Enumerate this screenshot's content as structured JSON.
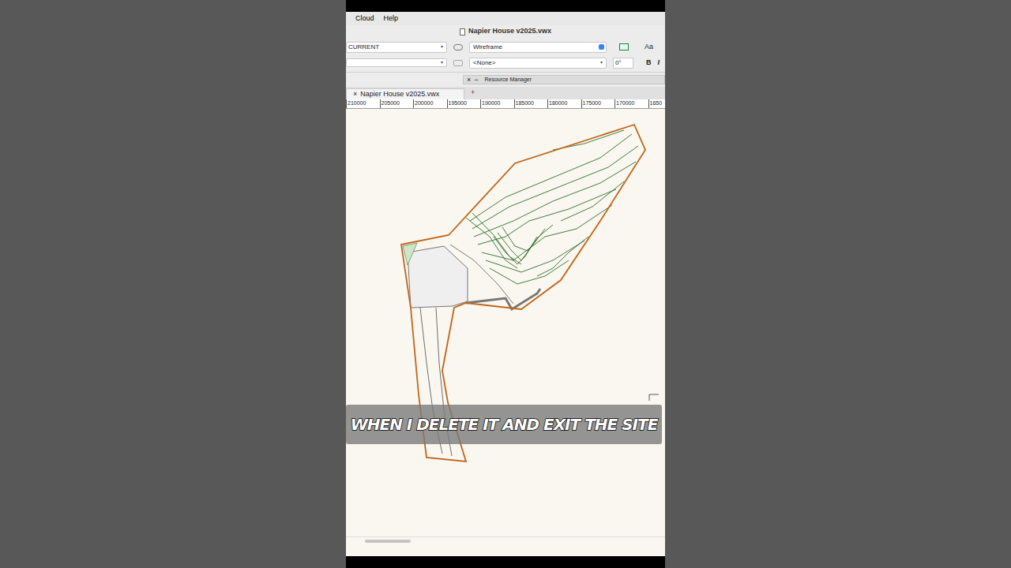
{
  "menu": [
    "Cloud",
    "Help"
  ],
  "window": {
    "title": "Napier House v2025.vwx"
  },
  "toolbar": {
    "class_field": "CURRENT",
    "render_mode": "Wireframe",
    "plane_field": "<None>",
    "rotation": "0°",
    "text_style": "Aa",
    "format_buttons": [
      "B",
      "I"
    ]
  },
  "palette": {
    "title": "Resource Manager",
    "close": "×",
    "collapse": "−"
  },
  "tabs": [
    {
      "label": "Napier House v2025.vwx",
      "close": "×",
      "selected": true
    }
  ],
  "new_tab": "+",
  "ruler": [
    "210000",
    "205000",
    "200000",
    "195000",
    "190000",
    "185000",
    "180000",
    "175000",
    "170000",
    "1650"
  ],
  "caption": "WHEN I DELETE IT AND EXIT THE SITE"
}
